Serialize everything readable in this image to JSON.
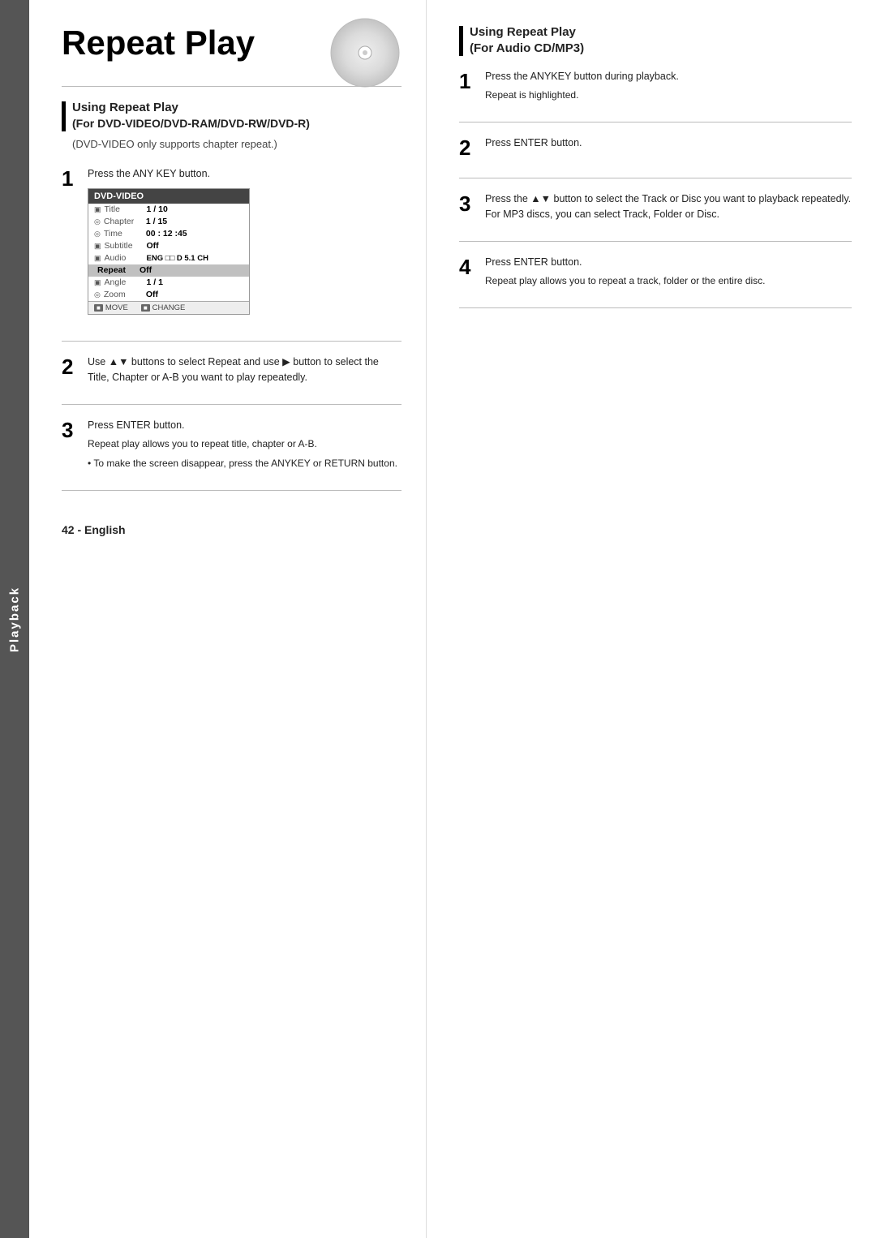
{
  "sidebar": {
    "label": "Playback"
  },
  "page": {
    "title": "Repeat Play",
    "page_number": "42 - English"
  },
  "left_section": {
    "heading": "Using Repeat Play",
    "subheading": "(For DVD-VIDEO/DVD-RAM/DVD-RW/DVD-R)",
    "note": "(DVD-VIDEO only supports chapter repeat.)",
    "steps": [
      {
        "number": "1",
        "text": "Press the ANY KEY button."
      },
      {
        "number": "2",
        "text": "Use ▲▼ buttons to select Repeat and use ▶ button to select the Title, Chapter or A-B you want to play repeatedly."
      },
      {
        "number": "3",
        "text": "Press ENTER button.",
        "subtext": "Repeat play allows you to repeat title, chapter or A-B.",
        "bullet": "• To make the screen disappear, press the ANYKEY or RETURN button."
      }
    ]
  },
  "dvd_menu": {
    "header": "DVD-VIDEO",
    "rows": [
      {
        "icon": "□",
        "label": "Title",
        "value": "1 / 10"
      },
      {
        "icon": "○",
        "label": "Chapter",
        "value": "1 / 15"
      },
      {
        "icon": "○",
        "label": "Time",
        "value": "00 : 12 :45"
      },
      {
        "icon": "□",
        "label": "Subtitle",
        "value": "Off"
      },
      {
        "icon": "□",
        "label": "Audio",
        "value": "ENG □□ D 5.1 CH"
      },
      {
        "icon": "",
        "label": "Repeat",
        "value": "Off",
        "highlighted": true
      },
      {
        "icon": "□",
        "label": "Angle",
        "value": "1 / 1"
      },
      {
        "icon": "○",
        "label": "Zoom",
        "value": "Off"
      }
    ],
    "footer": [
      {
        "key": "■",
        "label": "MOVE"
      },
      {
        "key": "■",
        "label": "CHANGE"
      }
    ]
  },
  "right_section": {
    "heading": "Using Repeat Play",
    "subheading": "(For Audio CD/MP3)",
    "steps": [
      {
        "number": "1",
        "text": "Press the ANYKEY button during playback.",
        "subtext": "Repeat is highlighted."
      },
      {
        "number": "2",
        "text": "Press ENTER button."
      },
      {
        "number": "3",
        "text": "Press the ▲▼ button to select the Track or Disc you want to playback repeatedly.  For MP3 discs, you can select Track, Folder or Disc."
      },
      {
        "number": "4",
        "text": "Press ENTER button.",
        "subtext": "Repeat play allows you to repeat a track, folder or the entire disc."
      }
    ]
  }
}
